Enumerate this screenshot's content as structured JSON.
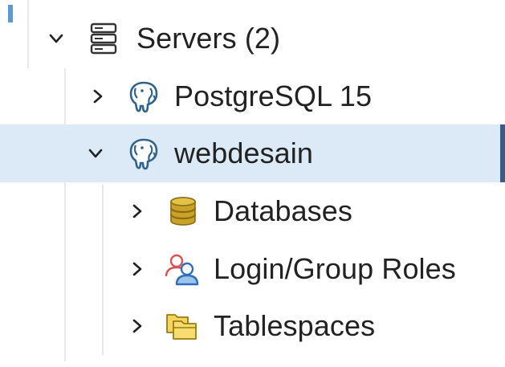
{
  "tree": {
    "servers": {
      "label": "Servers (2)",
      "expanded": true,
      "icon": "server-group-icon",
      "children": [
        {
          "label": "PostgreSQL 15",
          "icon": "postgres-elephant-icon",
          "expanded": false
        },
        {
          "label": "webdesain",
          "icon": "postgres-elephant-icon",
          "expanded": true,
          "selected": true,
          "children": [
            {
              "label": "Databases",
              "icon": "database-icon",
              "expanded": false
            },
            {
              "label": "Login/Group Roles",
              "icon": "group-roles-icon",
              "expanded": false
            },
            {
              "label": "Tablespaces",
              "icon": "tablespace-folder-icon",
              "expanded": false
            }
          ]
        }
      ]
    }
  },
  "colors": {
    "selection_bg": "#dbeaf6",
    "selection_bar": "#3a5a87",
    "elephant_blue": "#31648c",
    "database_gold": "#c9a227"
  }
}
